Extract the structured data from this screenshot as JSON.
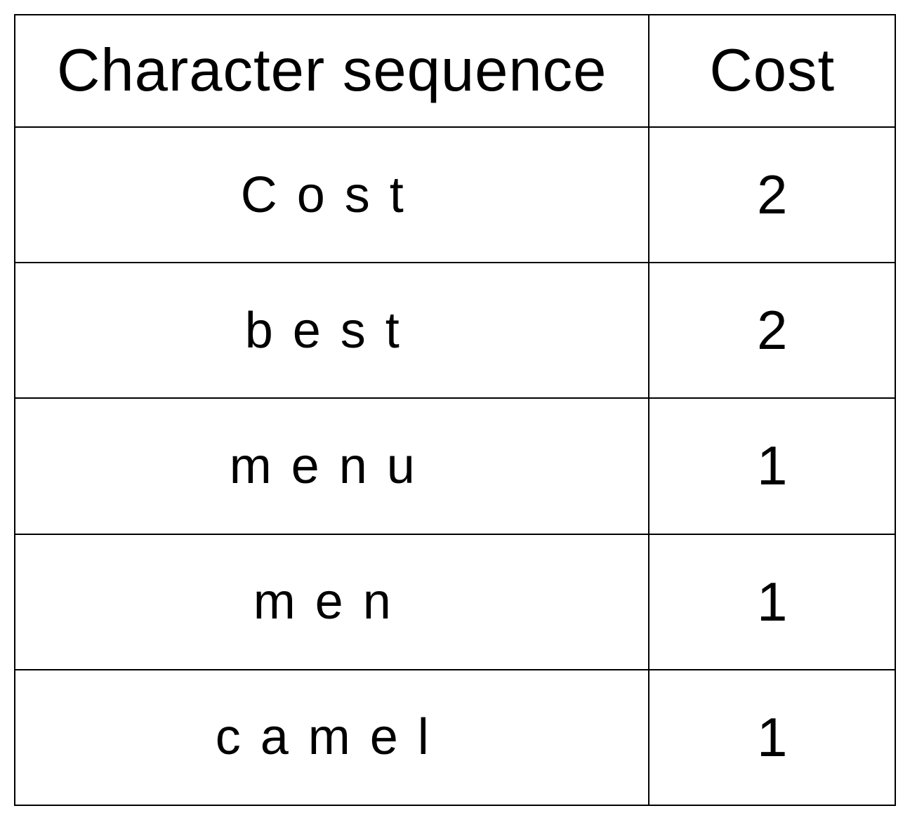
{
  "table": {
    "headers": {
      "sequence": "Character sequence",
      "cost": "Cost"
    },
    "rows": [
      {
        "sequence": "Cost",
        "cost": "2"
      },
      {
        "sequence": "best",
        "cost": "2"
      },
      {
        "sequence": "menu",
        "cost": "1"
      },
      {
        "sequence": "men",
        "cost": "1"
      },
      {
        "sequence": "camel",
        "cost": "1"
      }
    ]
  }
}
